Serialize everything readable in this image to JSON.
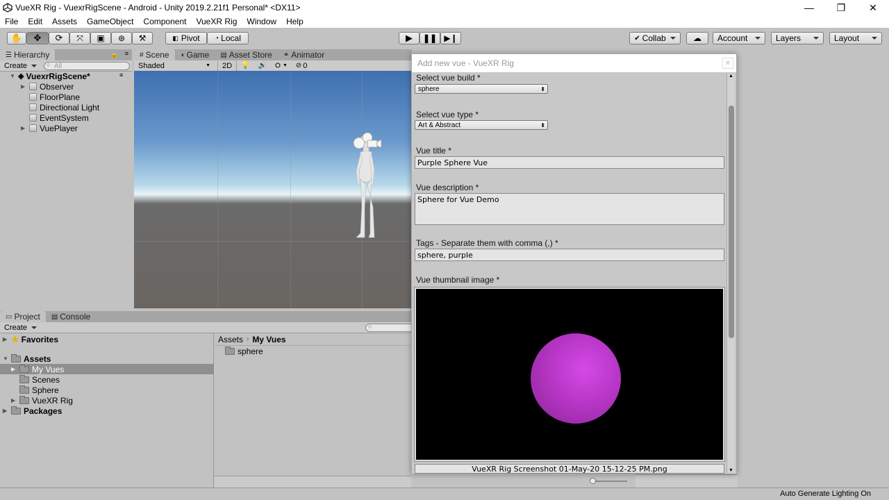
{
  "window": {
    "title": "VueXR Rig - VuexrRigScene - Android - Unity 2019.2.21f1 Personal* <DX11>",
    "minimize": "—",
    "restore": "❐",
    "close": "✕"
  },
  "menu": [
    "File",
    "Edit",
    "Assets",
    "GameObject",
    "Component",
    "VueXR Rig",
    "Window",
    "Help"
  ],
  "toolbar": {
    "pivot": "Pivot",
    "local": "Local",
    "collab": "Collab",
    "account": "Account",
    "layers": "Layers",
    "layout": "Layout"
  },
  "hierarchy": {
    "tab": "Hierarchy",
    "create": "Create",
    "search_placeholder": "All",
    "scene_name": "VuexrRigScene*",
    "items": [
      "Observer",
      "FloorPlane",
      "Directional Light",
      "EventSystem",
      "VuePlayer"
    ]
  },
  "scene": {
    "tabs": [
      "Scene",
      "Game",
      "Asset Store",
      "Animator"
    ],
    "shading": "Shaded",
    "mode_2d": "2D",
    "fx_count": "0"
  },
  "project": {
    "tabs": [
      "Project",
      "Console"
    ],
    "create": "Create",
    "favorites": "Favorites",
    "assets": "Assets",
    "asset_children": [
      "My Vues",
      "Scenes",
      "Sphere",
      "VueXR Rig"
    ],
    "packages": "Packages",
    "breadcrumb_root": "Assets",
    "breadcrumb_current": "My Vues",
    "folder_items": [
      "sphere"
    ]
  },
  "dialog": {
    "title": "Add new vue - VueXR Rig",
    "build_label": "Select vue build *",
    "build_value": "sphere",
    "type_label": "Select vue type *",
    "type_value": "Art & Abstract",
    "title_label": "Vue title *",
    "title_value": "Purple Sphere Vue",
    "desc_label": "Vue description *",
    "desc_value": "Sphere for Vue Demo",
    "tags_label": "Tags - Separate them with comma (,) *",
    "tags_value": "sphere, purple",
    "thumb_label": "Vue thumbnail image *",
    "thumb_filename": "VueXR Rig Screenshot 01-May-20 15-12-25 PM.png"
  },
  "status": {
    "lighting": "Auto Generate Lighting On"
  }
}
